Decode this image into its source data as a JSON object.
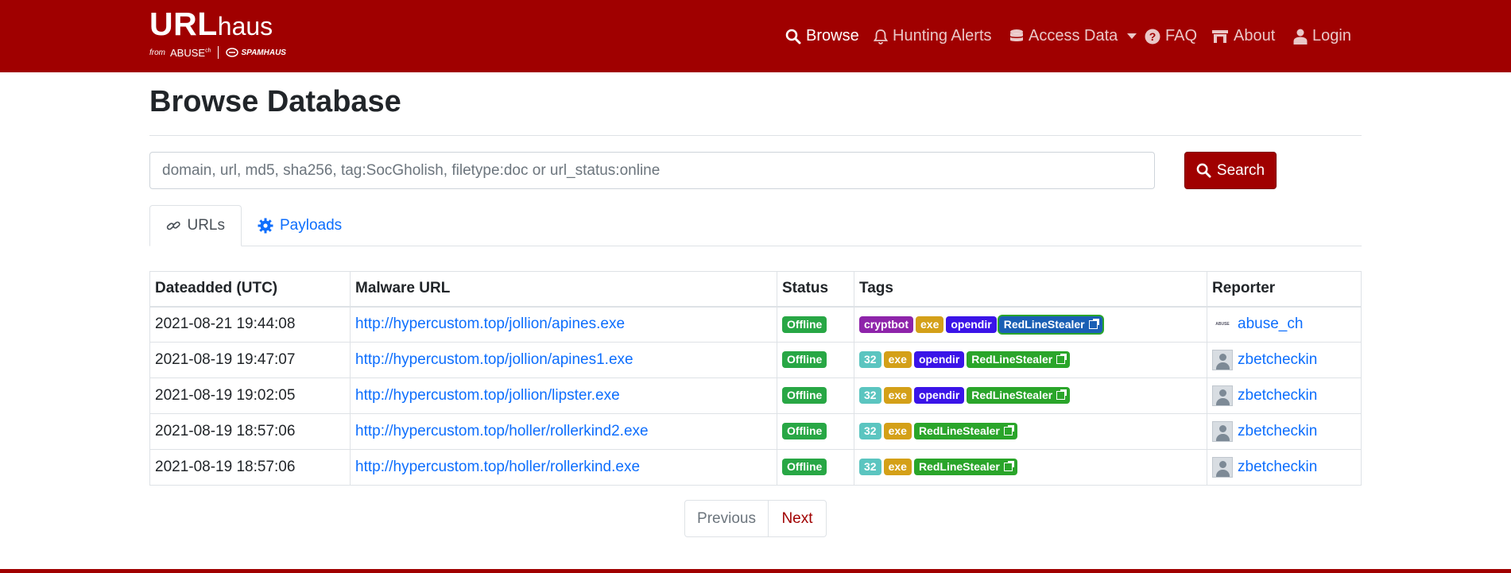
{
  "brand": {
    "name_bold": "URL",
    "name_light": "haus",
    "from": "from",
    "abuse": "ABUSE",
    "abuse_sup": "ch",
    "spamhaus": "SPAMHAUS"
  },
  "nav": {
    "browse": "Browse",
    "hunting": "Hunting Alerts",
    "access": "Access Data",
    "faq": "FAQ",
    "about": "About",
    "login": "Login"
  },
  "page": {
    "title": "Browse Database"
  },
  "search": {
    "placeholder": "domain, url, md5, sha256, tag:SocGholish, filetype:doc or url_status:online",
    "button": "Search"
  },
  "tabs": {
    "urls": "URLs",
    "payloads": "Payloads"
  },
  "table": {
    "headers": [
      "Dateadded (UTC)",
      "Malware URL",
      "Status",
      "Tags",
      "Reporter"
    ],
    "rows": [
      {
        "date": "2021-08-21 19:44:08",
        "url": "http://hypercustom.top/jollion/apines.exe",
        "status": "Offline",
        "tags": [
          "cryptbot",
          "exe",
          "opendir",
          "RedLineStealer"
        ],
        "reporter": "abuse_ch"
      },
      {
        "date": "2021-08-19 19:47:07",
        "url": "http://hypercustom.top/jollion/apines1.exe",
        "status": "Offline",
        "tags": [
          "32",
          "exe",
          "opendir",
          "RedLineStealer"
        ],
        "reporter": "zbetcheckin"
      },
      {
        "date": "2021-08-19 19:02:05",
        "url": "http://hypercustom.top/jollion/lipster.exe",
        "status": "Offline",
        "tags": [
          "32",
          "exe",
          "opendir",
          "RedLineStealer"
        ],
        "reporter": "zbetcheckin"
      },
      {
        "date": "2021-08-19 18:57:06",
        "url": "http://hypercustom.top/holler/rollerkind2.exe",
        "status": "Offline",
        "tags": [
          "32",
          "exe",
          "RedLineStealer"
        ],
        "reporter": "zbetcheckin"
      },
      {
        "date": "2021-08-19 18:57:06",
        "url": "http://hypercustom.top/holler/rollerkind.exe",
        "status": "Offline",
        "tags": [
          "32",
          "exe",
          "RedLineStealer"
        ],
        "reporter": "zbetcheckin"
      }
    ]
  },
  "pagination": {
    "previous": "Previous",
    "next": "Next"
  },
  "colors": {
    "brand_red": "#a00000",
    "link_blue": "#0d6efd",
    "offline_green": "#28a745"
  }
}
